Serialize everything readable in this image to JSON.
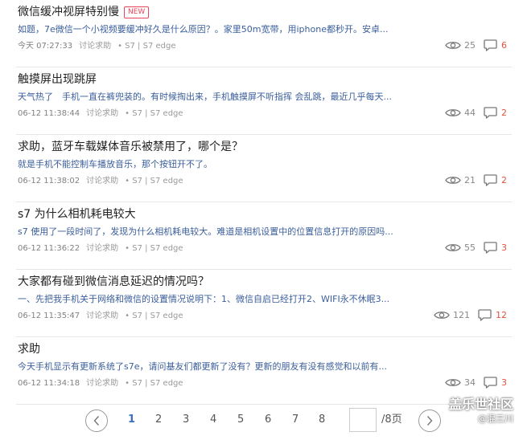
{
  "posts": [
    {
      "title": "微信缓冲视屏特别慢",
      "badge": "NEW",
      "excerpt": "如题，7e微信一个小视频要缓冲好久是什么原因？。家里50m宽带，用iphone都秒开。安卓...",
      "time": "今天 07:27:33",
      "category": "讨论求助",
      "tags": "• S7 | S7 edge",
      "views": "25",
      "replies": "6"
    },
    {
      "title": "触摸屏出现跳屏",
      "excerpt": "天气热了　手机一直在裤兜装的。有时候掏出来，手机触摸屏不听指挥 会乱跳，最近几乎每天...",
      "time": "06-12 11:38:44",
      "category": "讨论求助",
      "tags": "• S7 | S7 edge",
      "views": "44",
      "replies": "2"
    },
    {
      "title": "求助，蓝牙车载媒体音乐被禁用了，哪个是？",
      "excerpt": "就是手机不能控制车播放音乐，那个按钮开不了。",
      "time": "06-12 11:38:02",
      "category": "讨论求助",
      "tags": "• S7 | S7 edge",
      "views": "21",
      "replies": "2"
    },
    {
      "title": "s7 为什么相机耗电较大",
      "excerpt": "s7 使用了一段时间了，发现为什么相机耗电较大。难道是相机设置中的位置信息打开的原因吗...",
      "time": "06-12 11:36:22",
      "category": "讨论求助",
      "tags": "• S7 | S7 edge",
      "views": "55",
      "replies": "3"
    },
    {
      "title": "大家都有碰到微信消息延迟的情况吗？",
      "excerpt": "一、先把我手机关于网络和微信的设置情况说明下：1、微信自启已经打开2、WIFI永不休眠3...",
      "time": "06-12 11:35:47",
      "category": "讨论求助",
      "tags": "• S7 | S7 edge",
      "views": "121",
      "replies": "12"
    },
    {
      "title": "求助",
      "excerpt": "今天手机显示有更新系统了s7e，请问基友们都更新了没有？更新的朋友有没有感觉和以前有...",
      "time": "06-12 11:34:18",
      "category": "讨论求助",
      "tags": "• S7 | S7 edge",
      "views": "34",
      "replies": "3"
    }
  ],
  "pagination": {
    "pages": [
      "1",
      "2",
      "3",
      "4",
      "5",
      "6",
      "7",
      "8"
    ],
    "current": "1",
    "input_value": "",
    "total": "/8页"
  },
  "watermark": {
    "site": "盖乐世社区",
    "user": "@混三川"
  },
  "colors": {
    "excerpt": "#3a5e9b",
    "reply_count": "#e0533e",
    "badge": "#e8455b",
    "active_page": "#3a6fc4"
  },
  "icons": {
    "views": "eye-icon",
    "replies": "comment-bubble-icon",
    "prev": "chevron-left-icon",
    "next": "chevron-right-icon"
  }
}
